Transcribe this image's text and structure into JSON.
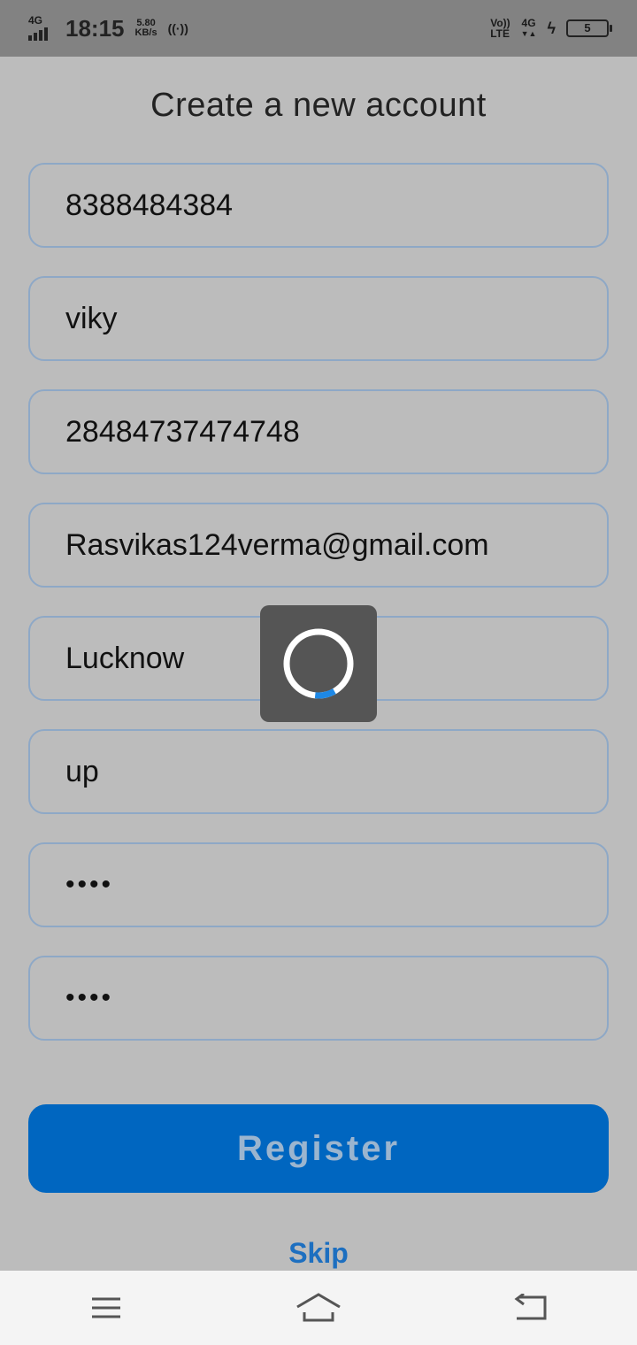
{
  "status_bar": {
    "network": "4G",
    "time": "18:15",
    "speed_value": "5.80",
    "speed_unit": "KB/s",
    "volte_top": "Vo))",
    "volte_bottom": "LTE",
    "net_right": "4G",
    "battery": "5"
  },
  "form": {
    "title": "Create a new account",
    "fields": [
      {
        "value": "8388484384"
      },
      {
        "value": "viky"
      },
      {
        "value": "28484737474748"
      },
      {
        "value": "Rasvikas124verma@gmail.com"
      },
      {
        "value": "Lucknow"
      },
      {
        "value": "up"
      },
      {
        "value": "••••"
      },
      {
        "value": "••••"
      }
    ],
    "register_label": "Register",
    "skip_label": "Skip"
  },
  "loader": {
    "progress": 0.1
  },
  "colors": {
    "accent": "#0066c0",
    "link": "#1d6fc0",
    "field_border": "#8ea8c6",
    "spinner": "#1e88e5"
  },
  "nav_bar": {
    "icons": [
      "menu-icon",
      "home-icon",
      "back-icon"
    ]
  }
}
